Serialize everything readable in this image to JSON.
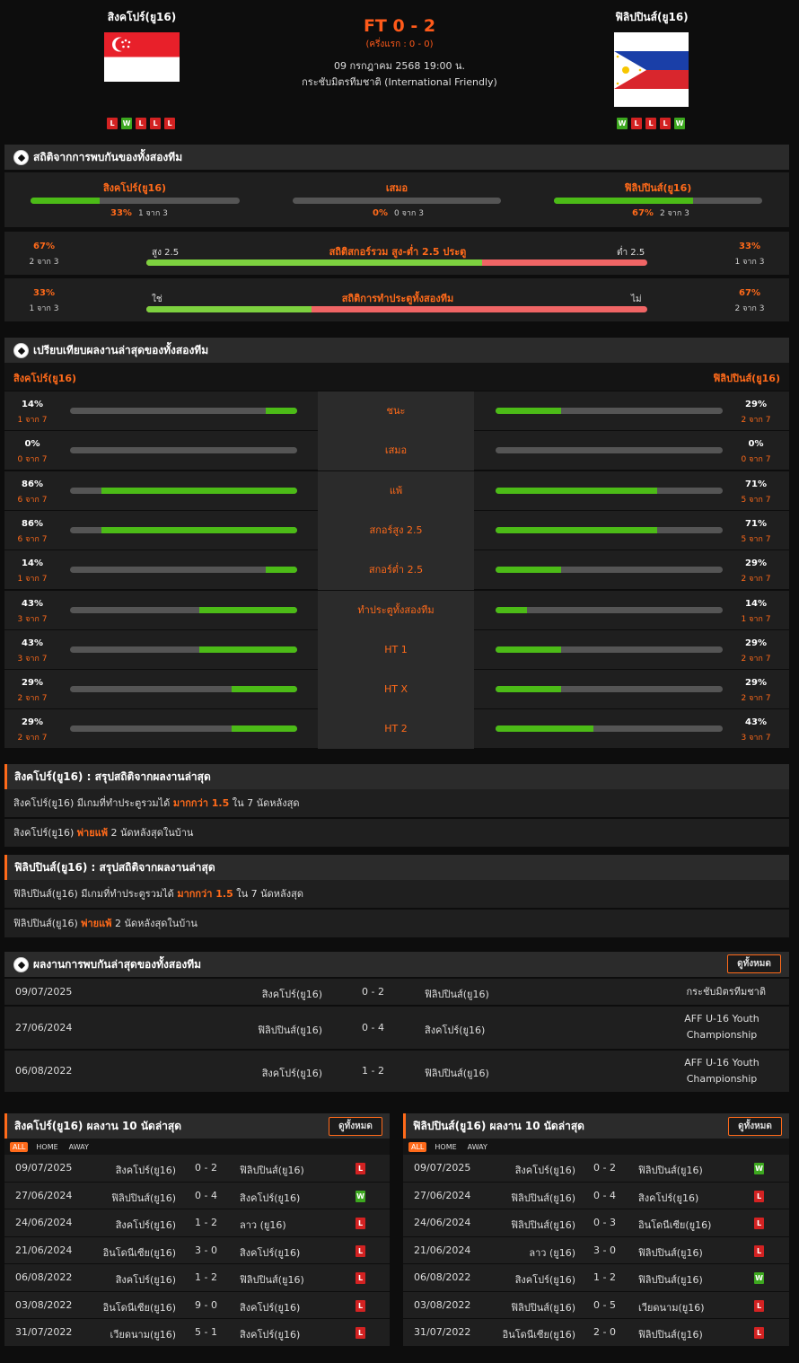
{
  "match": {
    "home": "สิงคโปร์(ยู16)",
    "away": "ฟิลิปปินส์(ยู16)",
    "score": "FT 0 - 2",
    "halftime": "(ครึ่งแรก : 0 - 0)",
    "datetime": "09 กรกฎาคม 2568 19:00 น.",
    "competition": "กระชับมิตรทีมชาติ (International Friendly)",
    "home_form": [
      "L",
      "W",
      "L",
      "L",
      "L"
    ],
    "away_form": [
      "W",
      "L",
      "L",
      "L",
      "W"
    ]
  },
  "h2h_stats": {
    "title": "สถิติจากการพบกันของทั้งสองทีม",
    "cols": [
      {
        "label": "สิงคโปร์(ยู16)",
        "pct": "33%",
        "sub": "1 จาก 3",
        "fill": 0.33
      },
      {
        "label": "เสมอ",
        "pct": "0%",
        "sub": "0 จาก 3",
        "fill": 0
      },
      {
        "label": "ฟิลิปปินส์(ยู16)",
        "pct": "67%",
        "sub": "2 จาก 3",
        "fill": 0.67
      }
    ],
    "ou": {
      "title": "สถิติสกอร์รวม สูง-ต่ำ 2.5 ประตู",
      "left_label": "สูง 2.5",
      "right_label": "ต่ำ 2.5",
      "left_pct": "67%",
      "left_sub": "2 จาก 3",
      "right_pct": "33%",
      "right_sub": "1 จาก 3",
      "fill": 0.67
    },
    "btts": {
      "title": "สถิติการทำประตูทั้งสองทีม",
      "left_label": "ใช่",
      "right_label": "ไม่",
      "left_pct": "33%",
      "left_sub": "1 จาก 3",
      "right_pct": "67%",
      "right_sub": "2 จาก 3",
      "fill": 0.33
    }
  },
  "compare": {
    "title": "เปรียบเทียบผลงานล่าสุดของทั้งสองทีม",
    "home": "สิงคโปร์(ยู16)",
    "away": "ฟิลิปปินส์(ยู16)",
    "rows": [
      {
        "label": "ชนะ",
        "l_pct": "14%",
        "l_sub": "1 จาก 7",
        "l_fill": 0.14,
        "r_pct": "29%",
        "r_sub": "2 จาก 7",
        "r_fill": 0.29
      },
      {
        "label": "เสมอ",
        "l_pct": "0%",
        "l_sub": "0 จาก 7",
        "l_fill": 0,
        "r_pct": "0%",
        "r_sub": "0 จาก 7",
        "r_fill": 0
      },
      {
        "label": "แพ้",
        "l_pct": "86%",
        "l_sub": "6 จาก 7",
        "l_fill": 0.86,
        "r_pct": "71%",
        "r_sub": "5 จาก 7",
        "r_fill": 0.71
      },
      {
        "label": "สกอร์สูง 2.5",
        "l_pct": "86%",
        "l_sub": "6 จาก 7",
        "l_fill": 0.86,
        "r_pct": "71%",
        "r_sub": "5 จาก 7",
        "r_fill": 0.71
      },
      {
        "label": "สกอร์ต่ำ 2.5",
        "l_pct": "14%",
        "l_sub": "1 จาก 7",
        "l_fill": 0.14,
        "r_pct": "29%",
        "r_sub": "2 จาก 7",
        "r_fill": 0.29
      },
      {
        "label": "ทำประตูทั้งสองทีม",
        "l_pct": "43%",
        "l_sub": "3 จาก 7",
        "l_fill": 0.43,
        "r_pct": "14%",
        "r_sub": "1 จาก 7",
        "r_fill": 0.14
      },
      {
        "label": "HT 1",
        "l_pct": "43%",
        "l_sub": "3 จาก 7",
        "l_fill": 0.43,
        "r_pct": "29%",
        "r_sub": "2 จาก 7",
        "r_fill": 0.29
      },
      {
        "label": "HT X",
        "l_pct": "29%",
        "l_sub": "2 จาก 7",
        "l_fill": 0.29,
        "r_pct": "29%",
        "r_sub": "2 จาก 7",
        "r_fill": 0.29
      },
      {
        "label": "HT 2",
        "l_pct": "29%",
        "l_sub": "2 จาก 7",
        "l_fill": 0.29,
        "r_pct": "43%",
        "r_sub": "3 จาก 7",
        "r_fill": 0.43
      }
    ]
  },
  "summary_home": {
    "title": "สิงคโปร์(ยู16) : สรุปสถิติจากผลงานล่าสุด",
    "l1_a": "สิงคโปร์(ยู16)  มีเกมที่ทำประตูรวมได้ ",
    "l1_b": "มากกว่า  1.5",
    "l1_c": "  ใน 7 นัดหลังสุด",
    "l2_a": "สิงคโปร์(ยู16) ",
    "l2_b": "พ่ายแพ้",
    "l2_c": "  2  นัดหลังสุดในบ้าน"
  },
  "summary_away": {
    "title": "ฟิลิปปินส์(ยู16) : สรุปสถิติจากผลงานล่าสุด",
    "l1_a": "ฟิลิปปินส์(ยู16)  มีเกมที่ทำประตูรวมได้ ",
    "l1_b": "มากกว่า  1.5",
    "l1_c": "  ใน 7 นัดหลังสุด",
    "l2_a": "ฟิลิปปินส์(ยู16) ",
    "l2_b": "พ่ายแพ้",
    "l2_c": "  2  นัดหลังสุดในบ้าน"
  },
  "h2h_list": {
    "title": "ผลงานการพบกันล่าสุดของทั้งสองทีม",
    "view_all": "ดูทั้งหมด",
    "rows": [
      {
        "date": "09/07/2025",
        "home": "สิงคโปร์(ยู16)",
        "score": "0 - 2",
        "away": "ฟิลิปปินส์(ยู16)",
        "comp1": "กระชับมิตรทีมชาติ",
        "comp2": ""
      },
      {
        "date": "27/06/2024",
        "home": "ฟิลิปปินส์(ยู16)",
        "score": "0 - 4",
        "away": "สิงคโปร์(ยู16)",
        "comp1": "AFF U-16 Youth",
        "comp2": "Championship"
      },
      {
        "date": "06/08/2022",
        "home": "สิงคโปร์(ยู16)",
        "score": "1 - 2",
        "away": "ฟิลิปปินส์(ยู16)",
        "comp1": "AFF U-16 Youth",
        "comp2": "Championship"
      }
    ]
  },
  "last10_home": {
    "title": "สิงคโปร์(ยู16) ผลงาน 10 นัดล่าสุด",
    "view_all": "ดูทั้งหมด",
    "tabs": [
      "ALL",
      "HOME",
      "AWAY"
    ],
    "rows": [
      {
        "date": "09/07/2025",
        "home": "สิงคโปร์(ยู16)",
        "score": "0 - 2",
        "away": "ฟิลิปปินส์(ยู16)",
        "res": "L"
      },
      {
        "date": "27/06/2024",
        "home": "ฟิลิปปินส์(ยู16)",
        "score": "0 - 4",
        "away": "สิงคโปร์(ยู16)",
        "res": "W"
      },
      {
        "date": "24/06/2024",
        "home": "สิงคโปร์(ยู16)",
        "score": "1 - 2",
        "away": "ลาว (ยู16)",
        "res": "L"
      },
      {
        "date": "21/06/2024",
        "home": "อินโดนีเซีย(ยู16)",
        "score": "3 - 0",
        "away": "สิงคโปร์(ยู16)",
        "res": "L"
      },
      {
        "date": "06/08/2022",
        "home": "สิงคโปร์(ยู16)",
        "score": "1 - 2",
        "away": "ฟิลิปปินส์(ยู16)",
        "res": "L"
      },
      {
        "date": "03/08/2022",
        "home": "อินโดนีเซีย(ยู16)",
        "score": "9 - 0",
        "away": "สิงคโปร์(ยู16)",
        "res": "L"
      },
      {
        "date": "31/07/2022",
        "home": "เวียดนาม(ยู16)",
        "score": "5 - 1",
        "away": "สิงคโปร์(ยู16)",
        "res": "L"
      }
    ]
  },
  "last10_away": {
    "title": "ฟิลิปปินส์(ยู16) ผลงาน 10 นัดล่าสุด",
    "view_all": "ดูทั้งหมด",
    "tabs": [
      "ALL",
      "HOME",
      "AWAY"
    ],
    "rows": [
      {
        "date": "09/07/2025",
        "home": "สิงคโปร์(ยู16)",
        "score": "0 - 2",
        "away": "ฟิลิปปินส์(ยู16)",
        "res": "W"
      },
      {
        "date": "27/06/2024",
        "home": "ฟิลิปปินส์(ยู16)",
        "score": "0 - 4",
        "away": "สิงคโปร์(ยู16)",
        "res": "L"
      },
      {
        "date": "24/06/2024",
        "home": "ฟิลิปปินส์(ยู16)",
        "score": "0 - 3",
        "away": "อินโดนีเซีย(ยู16)",
        "res": "L"
      },
      {
        "date": "21/06/2024",
        "home": "ลาว (ยู16)",
        "score": "3 - 0",
        "away": "ฟิลิปปินส์(ยู16)",
        "res": "L"
      },
      {
        "date": "06/08/2022",
        "home": "สิงคโปร์(ยู16)",
        "score": "1 - 2",
        "away": "ฟิลิปปินส์(ยู16)",
        "res": "W"
      },
      {
        "date": "03/08/2022",
        "home": "ฟิลิปปินส์(ยู16)",
        "score": "0 - 5",
        "away": "เวียดนาม(ยู16)",
        "res": "L"
      },
      {
        "date": "31/07/2022",
        "home": "อินโดนีเซีย(ยู16)",
        "score": "2 - 0",
        "away": "ฟิลิปปินส์(ยู16)",
        "res": "L"
      }
    ]
  }
}
